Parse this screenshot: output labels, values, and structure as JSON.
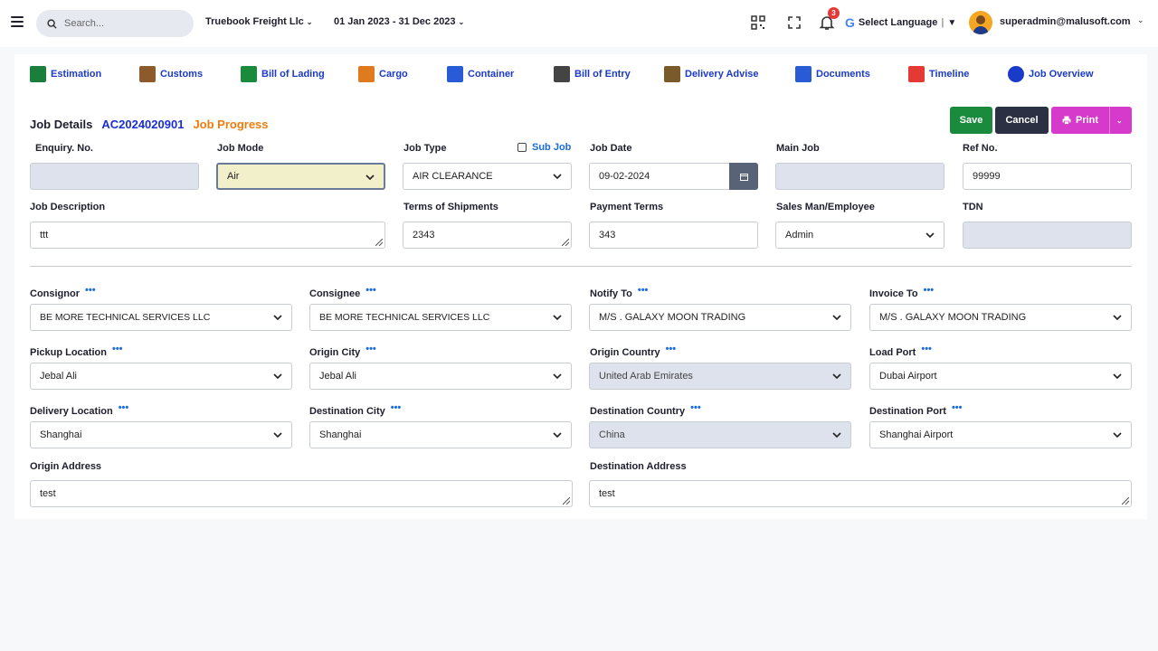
{
  "header": {
    "search_placeholder": "Search...",
    "company": "Truebook Freight Llc",
    "date_range": "01 Jan 2023 - 31 Dec 2023",
    "notifications_count": "3",
    "language_label": "Select Language",
    "language_arrow": "▼",
    "user_email": "superadmin@malusoft.com"
  },
  "tabs": [
    {
      "label": "Estimation",
      "icon": "estimation-icon",
      "color": "#1a7f3a"
    },
    {
      "label": "Customs",
      "icon": "customs-icon",
      "color": "#8c5a2b"
    },
    {
      "label": "Bill of Lading",
      "icon": "bill-of-lading-icon",
      "color": "#1a8a3c"
    },
    {
      "label": "Cargo",
      "icon": "cargo-icon",
      "color": "#e07a1f"
    },
    {
      "label": "Container",
      "icon": "container-icon",
      "color": "#2a5bd7"
    },
    {
      "label": "Bill of Entry",
      "icon": "bill-of-entry-icon",
      "color": "#444444"
    },
    {
      "label": "Delivery Advise",
      "icon": "delivery-advise-icon",
      "color": "#7a5a2b"
    },
    {
      "label": "Documents",
      "icon": "documents-icon",
      "color": "#2a5bd7"
    },
    {
      "label": "Timeline",
      "icon": "timeline-icon",
      "color": "#e53935"
    },
    {
      "label": "Job Overview",
      "icon": "job-overview-icon",
      "color": "#1a3ac9"
    }
  ],
  "job": {
    "title": "Job Details",
    "number": "AC2024020901",
    "progress_label": "Job Progress"
  },
  "buttons": {
    "save": "Save",
    "cancel": "Cancel",
    "print": "Print"
  },
  "fields": {
    "enquiry_no": {
      "label": "Enquiry. No.",
      "value": ""
    },
    "job_mode": {
      "label": "Job Mode",
      "value": "Air"
    },
    "job_type": {
      "label": "Job Type",
      "value": "AIR CLEARANCE"
    },
    "sub_job": {
      "label": "Sub Job",
      "checked": false
    },
    "job_date": {
      "label": "Job Date",
      "value": "09-02-2024"
    },
    "main_job": {
      "label": "Main Job",
      "value": ""
    },
    "ref_no": {
      "label": "Ref No.",
      "value": "99999"
    },
    "job_description": {
      "label": "Job Description",
      "value": "ttt"
    },
    "terms_of_shipments": {
      "label": "Terms of Shipments",
      "value": "2343"
    },
    "payment_terms": {
      "label": "Payment Terms",
      "value": "343"
    },
    "sales_man": {
      "label": "Sales Man/Employee",
      "value": "Admin"
    },
    "tdn": {
      "label": "TDN",
      "value": ""
    },
    "consignor": {
      "label": "Consignor",
      "value": "BE MORE TECHNICAL SERVICES LLC"
    },
    "consignee": {
      "label": "Consignee",
      "value": "BE MORE TECHNICAL SERVICES LLC"
    },
    "notify_to": {
      "label": "Notify To",
      "value": "M/S . GALAXY MOON TRADING"
    },
    "invoice_to": {
      "label": "Invoice To",
      "value": "M/S . GALAXY MOON TRADING"
    },
    "pickup_location": {
      "label": "Pickup Location",
      "value": "Jebal Ali"
    },
    "origin_city": {
      "label": "Origin City",
      "value": "Jebal Ali"
    },
    "origin_country": {
      "label": "Origin Country",
      "value": "United Arab Emirates"
    },
    "load_port": {
      "label": "Load Port",
      "value": "Dubai Airport"
    },
    "delivery_location": {
      "label": "Delivery Location",
      "value": "Shanghai"
    },
    "destination_city": {
      "label": "Destination City",
      "value": "Shanghai"
    },
    "destination_country": {
      "label": "Destination Country",
      "value": "China"
    },
    "destination_port": {
      "label": "Destination Port",
      "value": "Shanghai Airport"
    },
    "origin_address": {
      "label": "Origin Address",
      "value": "test"
    },
    "destination_address": {
      "label": "Destination Address",
      "value": "test"
    }
  },
  "more_dots": "•••"
}
